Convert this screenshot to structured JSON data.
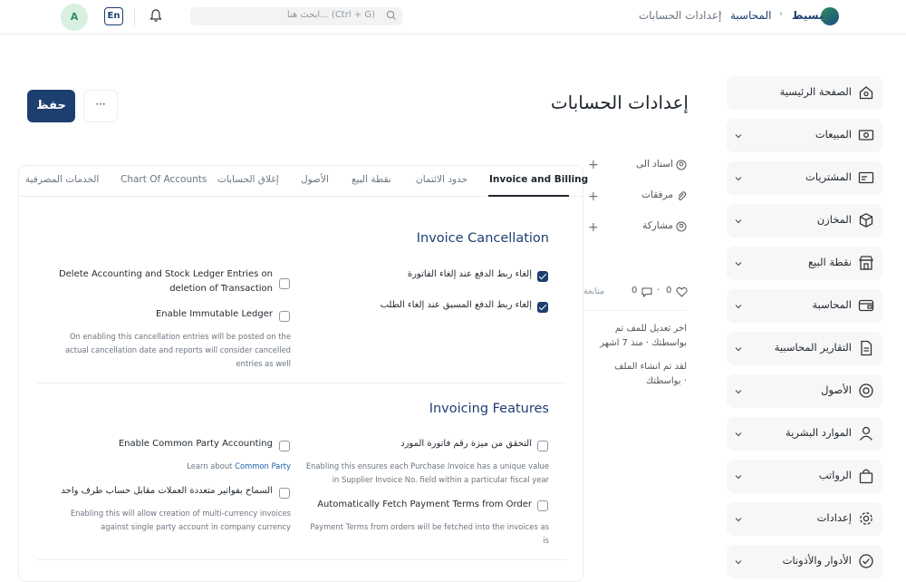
{
  "header": {
    "brand": "بسيط",
    "breadcrumbs": [
      "المحاسبة",
      "إعدادات الحسابات"
    ],
    "search_placeholder": "ابحث هنا... (Ctrl + G)",
    "lang_label": "En",
    "avatar_initial": "A"
  },
  "page": {
    "title": "إعدادات الحسابات",
    "save_label": "حفظ",
    "more_label": "···"
  },
  "sidebar": {
    "items": [
      {
        "label": "الصفحة الرئيسية",
        "icon": "home-icon"
      },
      {
        "label": "المبيعات",
        "icon": "cash-icon"
      },
      {
        "label": "المشتريات",
        "icon": "card-icon"
      },
      {
        "label": "المخازن",
        "icon": "box-icon"
      },
      {
        "label": "نقطة البيع",
        "icon": "store-icon"
      },
      {
        "label": "المحاسبة",
        "icon": "wallet-icon"
      },
      {
        "label": "التقارير المحاسبية",
        "icon": "report-icon"
      },
      {
        "label": "الأصول",
        "icon": "asset-icon"
      },
      {
        "label": "الموارد البشرية",
        "icon": "user-icon"
      },
      {
        "label": "الرواتب",
        "icon": "bag-icon"
      },
      {
        "label": "إعدادات",
        "icon": "gear-icon"
      },
      {
        "label": "الأدوار والأذونات",
        "icon": "shield-check-icon"
      }
    ]
  },
  "tabs": [
    {
      "label": "Invoice and Billing",
      "active": true
    },
    {
      "label": "حدود الائتمان"
    },
    {
      "label": "نقطة البيع"
    },
    {
      "label": "الأصول"
    },
    {
      "label": "إغلاق الحسابات"
    },
    {
      "label": "Chart Of Accounts"
    },
    {
      "label": "الخدمات المصرفية"
    }
  ],
  "invoice_cancellation": {
    "title": "Invoice Cancellation",
    "right": [
      {
        "label": "إلغاء ربط الدفع عند إلغاء الفاتورة",
        "checked": true
      },
      {
        "label": "إلغاء ربط الدفع المسبق عند إلغاء الطلب",
        "checked": true
      }
    ],
    "left": [
      {
        "label_line1": "Delete Accounting and Stock Ledger Entries on",
        "label_line2": "deletion of Transaction",
        "checked": false
      },
      {
        "label": "Enable Immutable Ledger",
        "checked": false,
        "desc_line1": "On enabling this cancellation entries will be posted on the",
        "desc_line2": "actual cancellation date and reports will consider cancelled",
        "desc_line3": "entries as well"
      }
    ]
  },
  "invoicing_features": {
    "title": "Invoicing Features",
    "right": [
      {
        "label": "التحقق من ميزة رقم فاتورة المورد",
        "checked": false,
        "desc_line1": "Enabling this ensures each Purchase Invoice has a unique value",
        "desc_line2": "in Supplier Invoice No. field within a particular fiscal year"
      },
      {
        "label": "Automatically Fetch Payment Terms from Order",
        "checked": false,
        "desc_line1": "Payment Terms from orders will be fetched into the invoices as",
        "desc_line2": "is"
      }
    ],
    "left": [
      {
        "label": "Enable Common Party Accounting",
        "checked": false,
        "desc_prefix": "Learn about",
        "desc_link": "Common Party"
      },
      {
        "label": "السماح بفواتير متعددة العملات مقابل حساب طرف واحد",
        "checked": false,
        "desc_line1": "Enabling this will allow creation of multi-currency invoices",
        "desc_line2": "against single party account in company currency"
      }
    ]
  },
  "side_panel": {
    "assigned_to": "اسناد الى",
    "attachments": "مرفقات",
    "share": "مشاركة",
    "likes": "0",
    "comments": "0",
    "follow": "متابعة",
    "activity_1_line1": "اخر تعديل للمف تم",
    "activity_1_line2": "بواسطتك · منذ 7 اشهر",
    "activity_2_line1": "لقد تم انشاء الملف",
    "activity_2_line2": "بواسطتك ·"
  }
}
